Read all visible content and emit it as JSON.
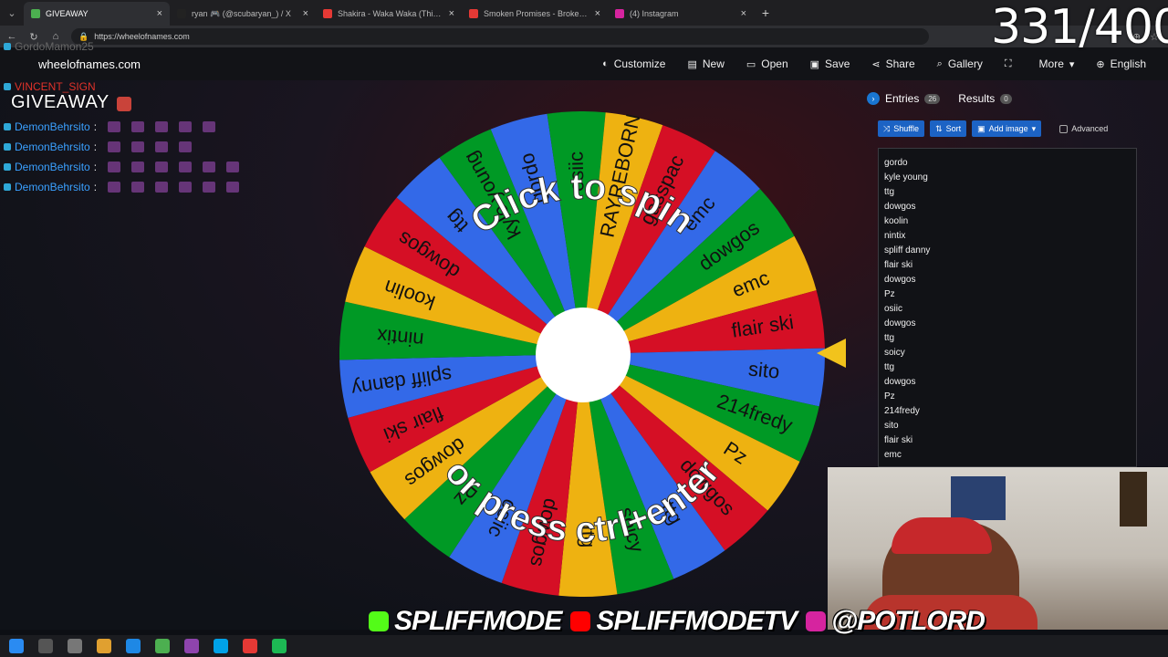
{
  "browser": {
    "tabs": [
      {
        "title": "GIVEAWAY",
        "active": true,
        "favicon_color": "#4caf50"
      },
      {
        "title": "ryan 🎮 (@scubaryan_) / X",
        "active": false,
        "favicon_color": "#222222"
      },
      {
        "title": "Shakira - Waka Waka (This Tim",
        "active": false,
        "favicon_color": "#e53935"
      },
      {
        "title": "Smoken Promises - Broken Promi",
        "active": false,
        "favicon_color": "#e53935"
      },
      {
        "title": "(4) Instagram",
        "active": false,
        "favicon_color": "#d6249f"
      }
    ],
    "url": "https://wheelofnames.com"
  },
  "site": {
    "logo": "wheelofnames.com",
    "menu": [
      {
        "label": "Customize",
        "icon": "palette-icon"
      },
      {
        "label": "New",
        "icon": "file-icon"
      },
      {
        "label": "Open",
        "icon": "folder-icon"
      },
      {
        "label": "Save",
        "icon": "save-icon"
      },
      {
        "label": "Share",
        "icon": "share-icon"
      },
      {
        "label": "Gallery",
        "icon": "search-icon"
      },
      {
        "label": "",
        "icon": "fullscreen-icon"
      },
      {
        "label": "More",
        "icon": "chevron-down-icon"
      },
      {
        "label": "English",
        "icon": "globe-icon"
      }
    ]
  },
  "chat": {
    "title": "GIVEAWAY",
    "lines": [
      {
        "name": "GordoMamon25",
        "style": "faded"
      },
      {
        "name": "VINCENT_SIGN",
        "style": "red"
      },
      {
        "name": "DemonBehrsito",
        "style": "blue",
        "emotes": 5
      },
      {
        "name": "DemonBehrsito",
        "style": "blue",
        "emotes": 4
      },
      {
        "name": "DemonBehrsito",
        "style": "blue",
        "emotes": 6
      },
      {
        "name": "DemonBehrsito",
        "style": "blue",
        "emotes": 6
      }
    ]
  },
  "wheel": {
    "top_text": "Click to spin",
    "bottom_text": "or press ctrl+enter",
    "colors": [
      "#3369e8",
      "#009925",
      "#eeb211",
      "#d50f25"
    ],
    "segments": [
      "gordo",
      "osiic",
      "RAYREBORN",
      "gasspac",
      "emc",
      "dowgos",
      "emc",
      "flair ski",
      "sito",
      "214fredy",
      "Pz",
      "dowgos",
      "ttg",
      "soicy",
      "ttg",
      "dowgos",
      "osiic",
      "Pz",
      "dowgos",
      "flair ski",
      "spliff danny",
      "nintix",
      "koolin",
      "dowgos",
      "ttg",
      "kyle young"
    ]
  },
  "panel": {
    "entries_label": "Entries",
    "entries_count": "26",
    "results_label": "Results",
    "results_count": "0",
    "tools": {
      "shuffle": "Shuffle",
      "sort": "Sort",
      "add_image": "Add image",
      "advanced": "Advanced"
    },
    "entries": [
      "gordo",
      "kyle young",
      "ttg",
      "dowgos",
      "koolin",
      "nintix",
      "spliff danny",
      "flair ski",
      "dowgos",
      "Pz",
      "osiic",
      "dowgos",
      "ttg",
      "soicy",
      "ttg",
      "dowgos",
      "Pz",
      "214fredy",
      "sito",
      "flair ski",
      "emc"
    ]
  },
  "counter": "331/400",
  "socials": [
    {
      "handle": "SPLIFFMODE",
      "icon": "kick-icon",
      "color": "#53fc18"
    },
    {
      "handle": "SPLIFFMODETV",
      "icon": "youtube-icon",
      "color": "#ff0000"
    },
    {
      "handle": "@POTLORD",
      "icon": "instagram-icon",
      "color": "#d6249f"
    }
  ]
}
